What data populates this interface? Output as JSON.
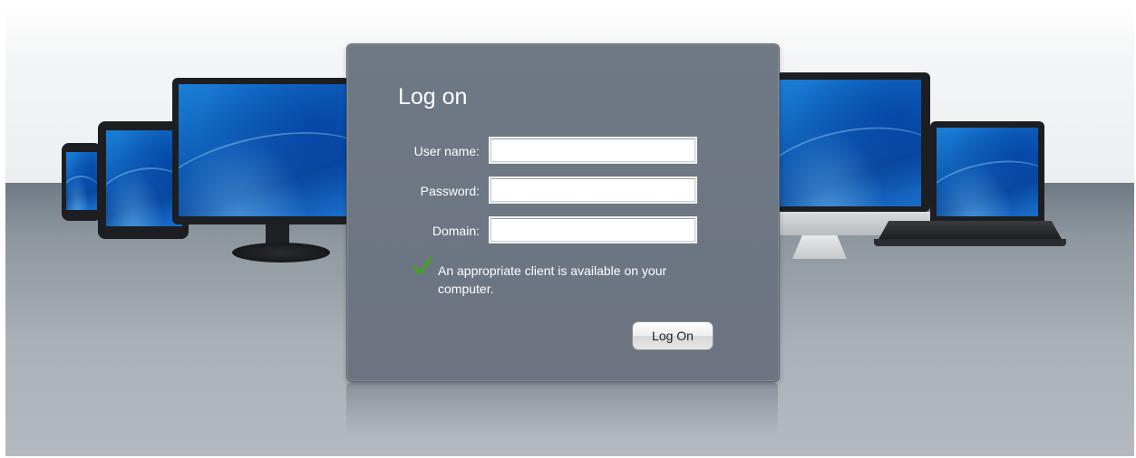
{
  "login": {
    "title": "Log on",
    "username_label": "User name:",
    "username_value": "",
    "password_label": "Password:",
    "password_value": "",
    "domain_label": "Domain:",
    "domain_value": "",
    "client_notice": "An appropriate client is available on your computer.",
    "logon_button": "Log On"
  },
  "icons": {
    "status": "checkmark-icon"
  },
  "colors": {
    "panel": "#6f7985",
    "checkmark": "#3fa614",
    "screen_blue": "#0f5fb8"
  }
}
